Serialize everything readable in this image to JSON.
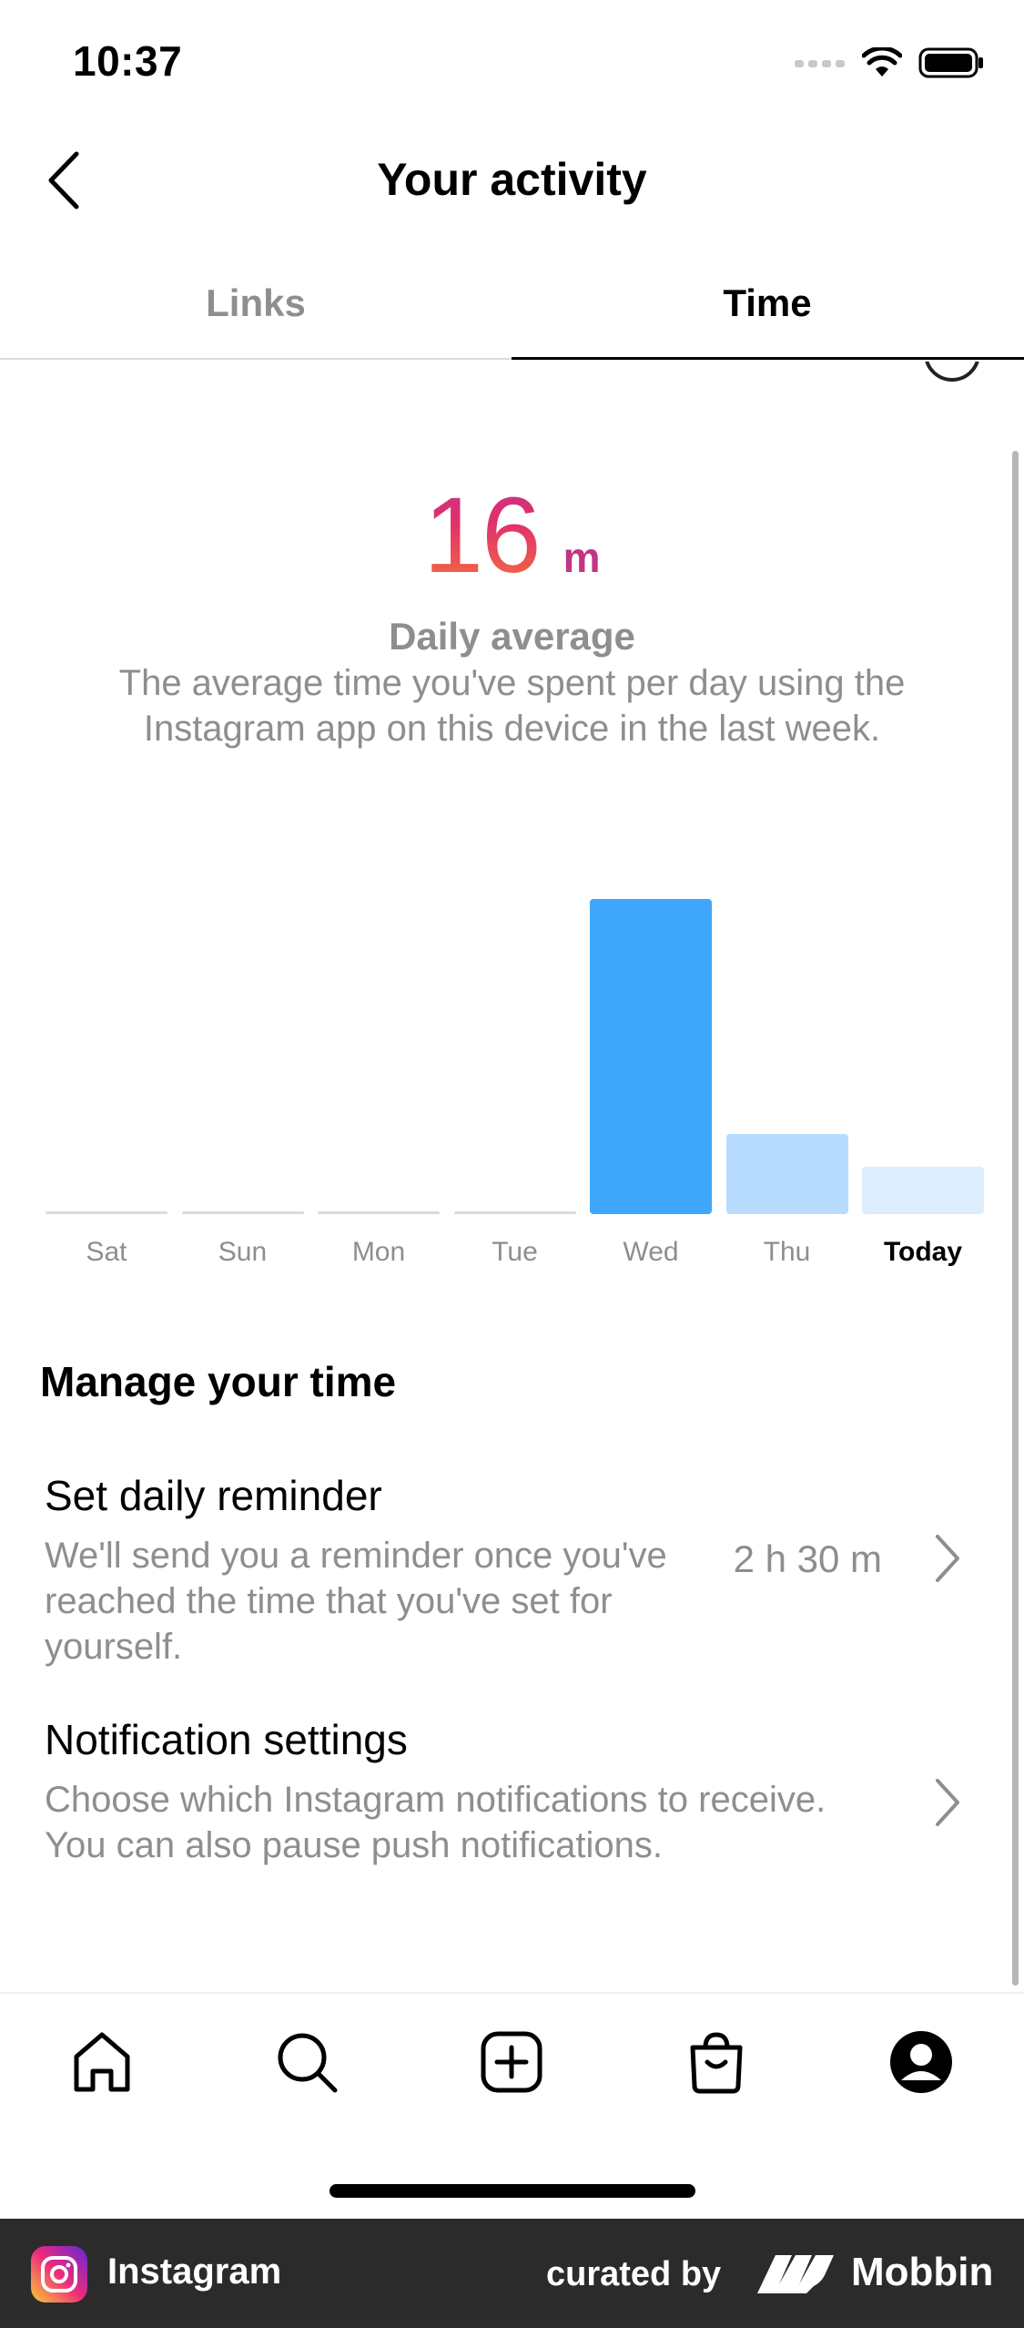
{
  "status_bar": {
    "time": "10:37"
  },
  "header": {
    "title": "Your activity"
  },
  "tabs": [
    {
      "label": "Links",
      "active": false
    },
    {
      "label": "Time",
      "active": true
    }
  ],
  "summary": {
    "value": "16",
    "unit": "m",
    "title": "Daily average",
    "description": "The average time you've spent per day using the Instagram app on this device in the last week."
  },
  "chart_data": {
    "type": "bar",
    "categories": [
      "Sat",
      "Sun",
      "Mon",
      "Tue",
      "Wed",
      "Thu",
      "Today"
    ],
    "values": [
      0,
      0,
      0,
      0,
      87,
      22,
      13
    ],
    "highlight_category": "Wed",
    "ylim": [
      0,
      90
    ],
    "grid": false,
    "colors": {
      "active": "#3ea6fb",
      "inactive": "#b7dcfd",
      "today": "#dcedfd",
      "empty": "#dbdbdb"
    },
    "title": "",
    "xlabel": "",
    "ylabel": ""
  },
  "manage": {
    "title": "Manage your time",
    "items": [
      {
        "title": "Set daily reminder",
        "description": "We'll send you a reminder once you've reached the time that you've set for yourself.",
        "value": "2 h 30 m"
      },
      {
        "title": "Notification settings",
        "description": "Choose which Instagram notifications to receive. You can also pause push notifications."
      }
    ]
  },
  "bottom_nav": {
    "items": [
      "home-icon",
      "search-icon",
      "create-icon",
      "shop-icon",
      "profile-icon"
    ]
  },
  "footer": {
    "app_name": "Instagram",
    "curated_label": "curated by",
    "brand": "Mobbin"
  }
}
